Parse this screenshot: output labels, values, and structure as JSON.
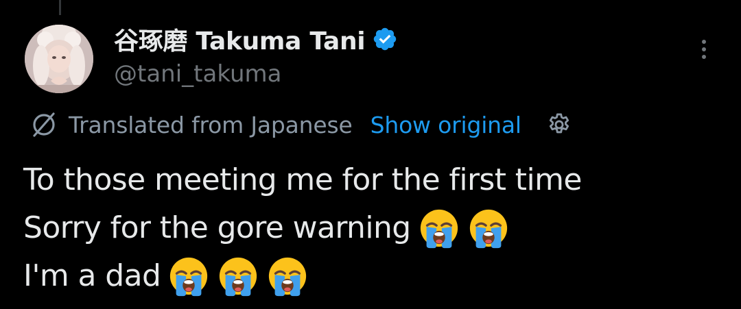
{
  "tweet": {
    "author": {
      "display_name": "谷琢磨 Takuma Tani",
      "handle": "@tani_takuma",
      "verified": true,
      "avatar_icon": "profile-photo"
    },
    "more_icon": "more-horizontal-icon",
    "translation": {
      "label": "Translated from Japanese",
      "action": "Show original",
      "icon": "translate-icon",
      "settings_icon": "gear-icon"
    },
    "text_lines": [
      {
        "text": "To those meeting me for the first time",
        "emoji": "",
        "emoji_count": 0
      },
      {
        "text": "Sorry for the gore warning",
        "emoji": "😭",
        "emoji_count": 2
      },
      {
        "text": "I'm a dad",
        "emoji": "😭",
        "emoji_count": 3
      }
    ]
  },
  "colors": {
    "background": "#000000",
    "text_primary": "#e7e9ea",
    "text_secondary": "#71767b",
    "link": "#1d9bf0",
    "verified": "#1d9bf0"
  }
}
